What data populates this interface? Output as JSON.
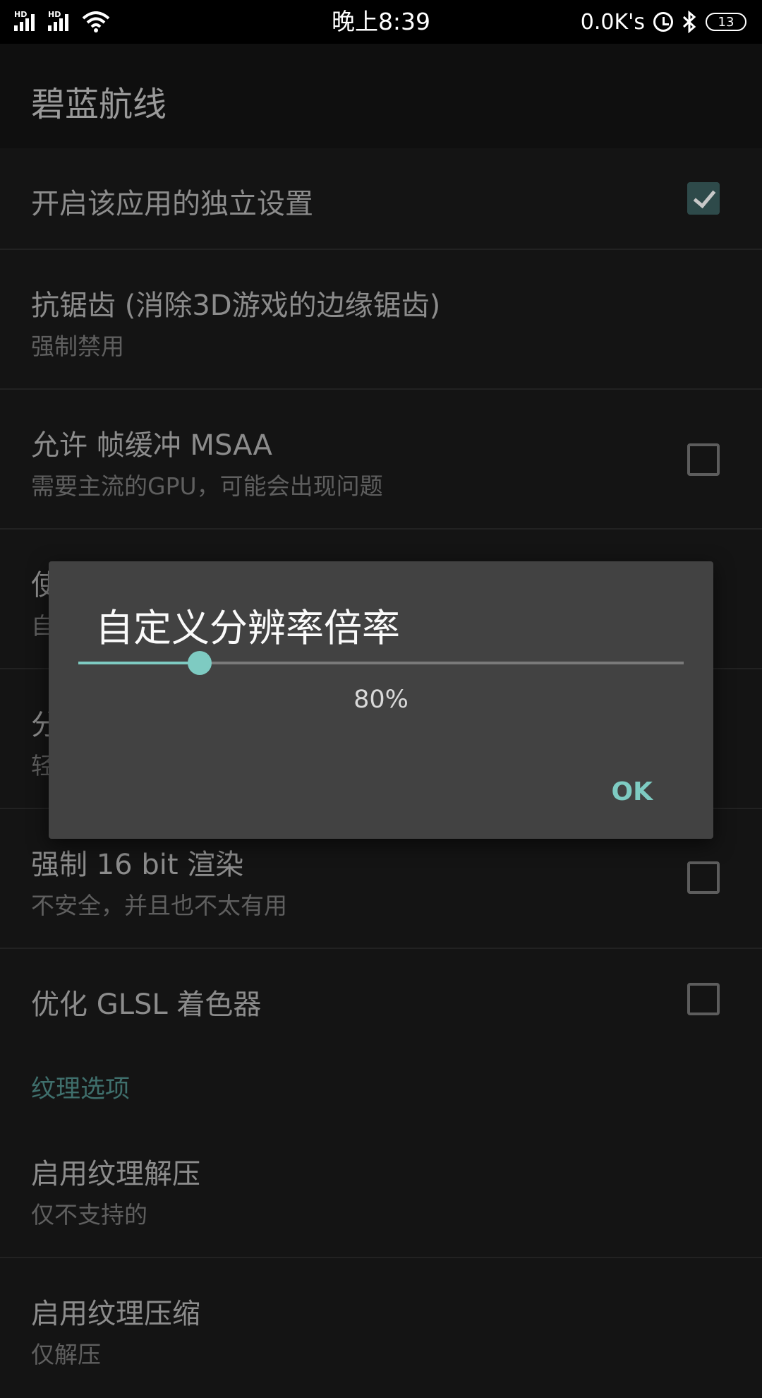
{
  "status_bar": {
    "signal1_label": "HD",
    "signal2_label": "HD",
    "time": "晚上8:39",
    "net_speed": "0.0K's",
    "battery": "13"
  },
  "app_bar": {
    "title": "碧蓝航线"
  },
  "settings": [
    {
      "title": "开启该应用的独立设置",
      "subtitle": "",
      "checkbox": true,
      "checked": true
    },
    {
      "title": "抗锯齿 (消除3D游戏的边缘锯齿)",
      "subtitle": "强制禁用",
      "checkbox": false
    },
    {
      "title": "允许 帧缓冲 MSAA",
      "subtitle": "需要主流的GPU，可能会出现问题",
      "checkbox": true,
      "checked": false
    },
    {
      "title": "使",
      "subtitle": "自",
      "checkbox": false
    },
    {
      "title": "分",
      "subtitle": "轻",
      "checkbox": false
    },
    {
      "title": "强制 16 bit 渲染",
      "subtitle": "不安全，并且也不太有用",
      "checkbox": true,
      "checked": false
    },
    {
      "title": "优化 GLSL 着色器",
      "subtitle": "",
      "checkbox": true,
      "checked": false
    }
  ],
  "texture_section": {
    "header": "纹理选项",
    "items": [
      {
        "title": "启用纹理解压",
        "subtitle": "仅不支持的"
      },
      {
        "title": "启用纹理压缩",
        "subtitle": "仅解压"
      }
    ]
  },
  "dialog": {
    "title": "自定义分辨率倍率",
    "slider_fraction": 0.2,
    "value_label": "80%",
    "ok_label": "OK"
  },
  "colors": {
    "accent": "#7ecbc2",
    "dialog_bg": "#424242",
    "background": "#141414"
  }
}
